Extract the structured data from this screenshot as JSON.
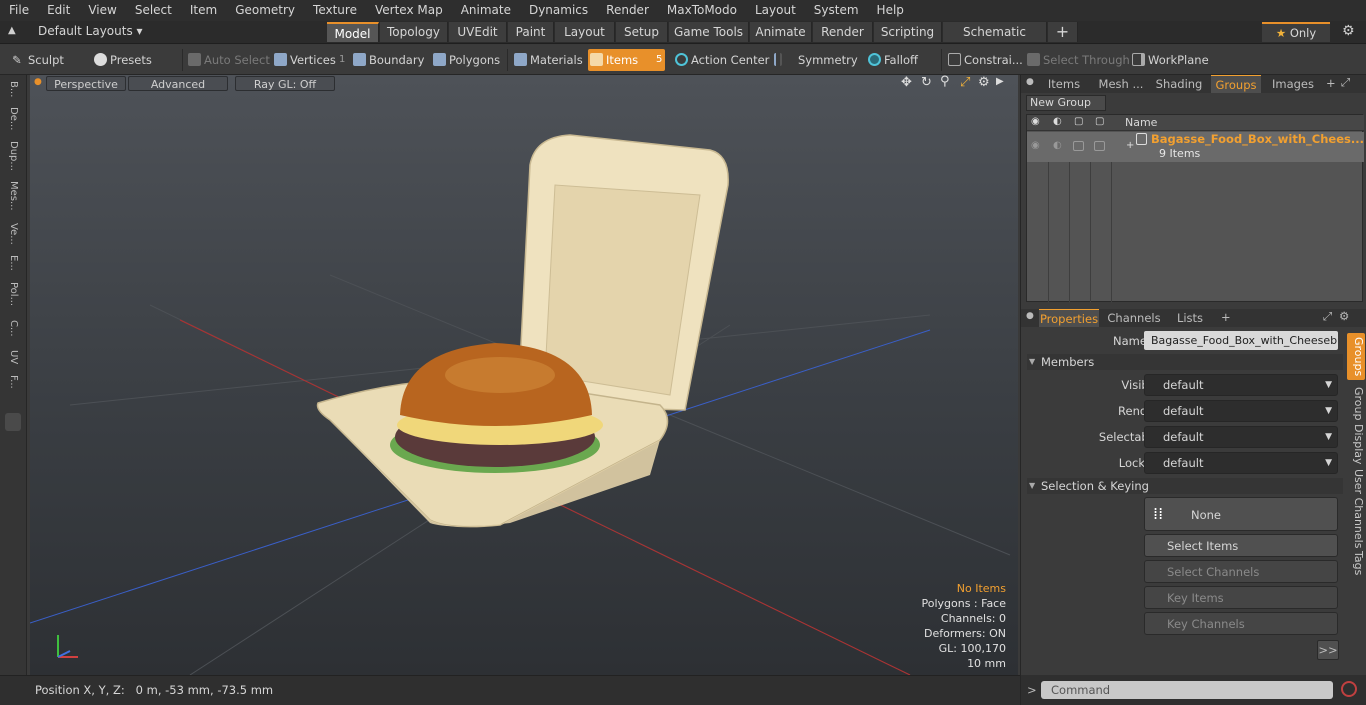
{
  "menubar": {
    "items": [
      "File",
      "Edit",
      "View",
      "Select",
      "Item",
      "Geometry",
      "Texture",
      "Vertex Map",
      "Animate",
      "Dynamics",
      "Render",
      "MaxToModo",
      "Layout",
      "System",
      "Help"
    ]
  },
  "layouts": {
    "label": "Default Layouts"
  },
  "mode_tabs": [
    "Model",
    "Topology",
    "UVEdit",
    "Paint",
    "Layout",
    "Setup",
    "Game Tools",
    "Animate",
    "Render",
    "Scripting",
    "Schematic Fusion"
  ],
  "only_label": "Only",
  "toolbar": {
    "sculpt": "Sculpt",
    "presets": "Presets",
    "auto_select": "Auto Select",
    "vertices": "Vertices",
    "vertices_count": "1",
    "boundary": "Boundary",
    "polygons": "Polygons",
    "materials": "Materials",
    "items": "Items",
    "items_count": "5",
    "action_center": "Action Center",
    "symmetry": "Symmetry",
    "falloff": "Falloff",
    "constraints": "Constrai...",
    "select_through": "Select Through",
    "workplane": "WorkPlane"
  },
  "left_tabs": [
    "B...",
    "De...",
    "Dup...",
    "Mes...",
    "Ve...",
    "E...",
    "Pol...",
    "C...",
    "UV",
    "F..."
  ],
  "viewport": {
    "perspective": "Perspective",
    "advanced": "Advanced",
    "raygl": "Ray GL: Off",
    "info": {
      "no_items": "No Items",
      "polygons": "Polygons : Face",
      "channels": "Channels: 0",
      "deformers": "Deformers: ON",
      "gl": "GL: 100,170",
      "scale": "10 mm"
    }
  },
  "status": {
    "position": "Position X, Y, Z:   0 m, -53 mm, -73.5 mm"
  },
  "groups_panel": {
    "tabs": [
      "Items",
      "Mesh ...",
      "Shading",
      "Groups",
      "Images"
    ],
    "new_group": "New Group",
    "col_name": "Name",
    "group_name": "Bagasse_Food_Box_with_Chees...",
    "group_count": "9 Items"
  },
  "properties_panel": {
    "tabs": [
      "Properties",
      "Channels",
      "Lists"
    ],
    "name_label": "Name",
    "name_value": "Bagasse_Food_Box_with_Cheeseburg",
    "members_label": "Members",
    "rows": [
      {
        "label": "Visible",
        "value": "default"
      },
      {
        "label": "Render",
        "value": "default"
      },
      {
        "label": "Selectable",
        "value": "default"
      },
      {
        "label": "Locked",
        "value": "default"
      }
    ],
    "selection_keying": "Selection & Keying",
    "none_label": "None",
    "select_items": "Select Items",
    "select_channels": "Select Channels",
    "key_items": "Key Items",
    "key_channels": "Key Channels",
    "more": ">>",
    "side_tabs": [
      "Groups",
      "Group Display",
      "User Channels",
      "Tags"
    ]
  },
  "command": {
    "placeholder": "Command"
  },
  "colors": {
    "accent": "#f2a030",
    "items_active": "#e8902a"
  }
}
